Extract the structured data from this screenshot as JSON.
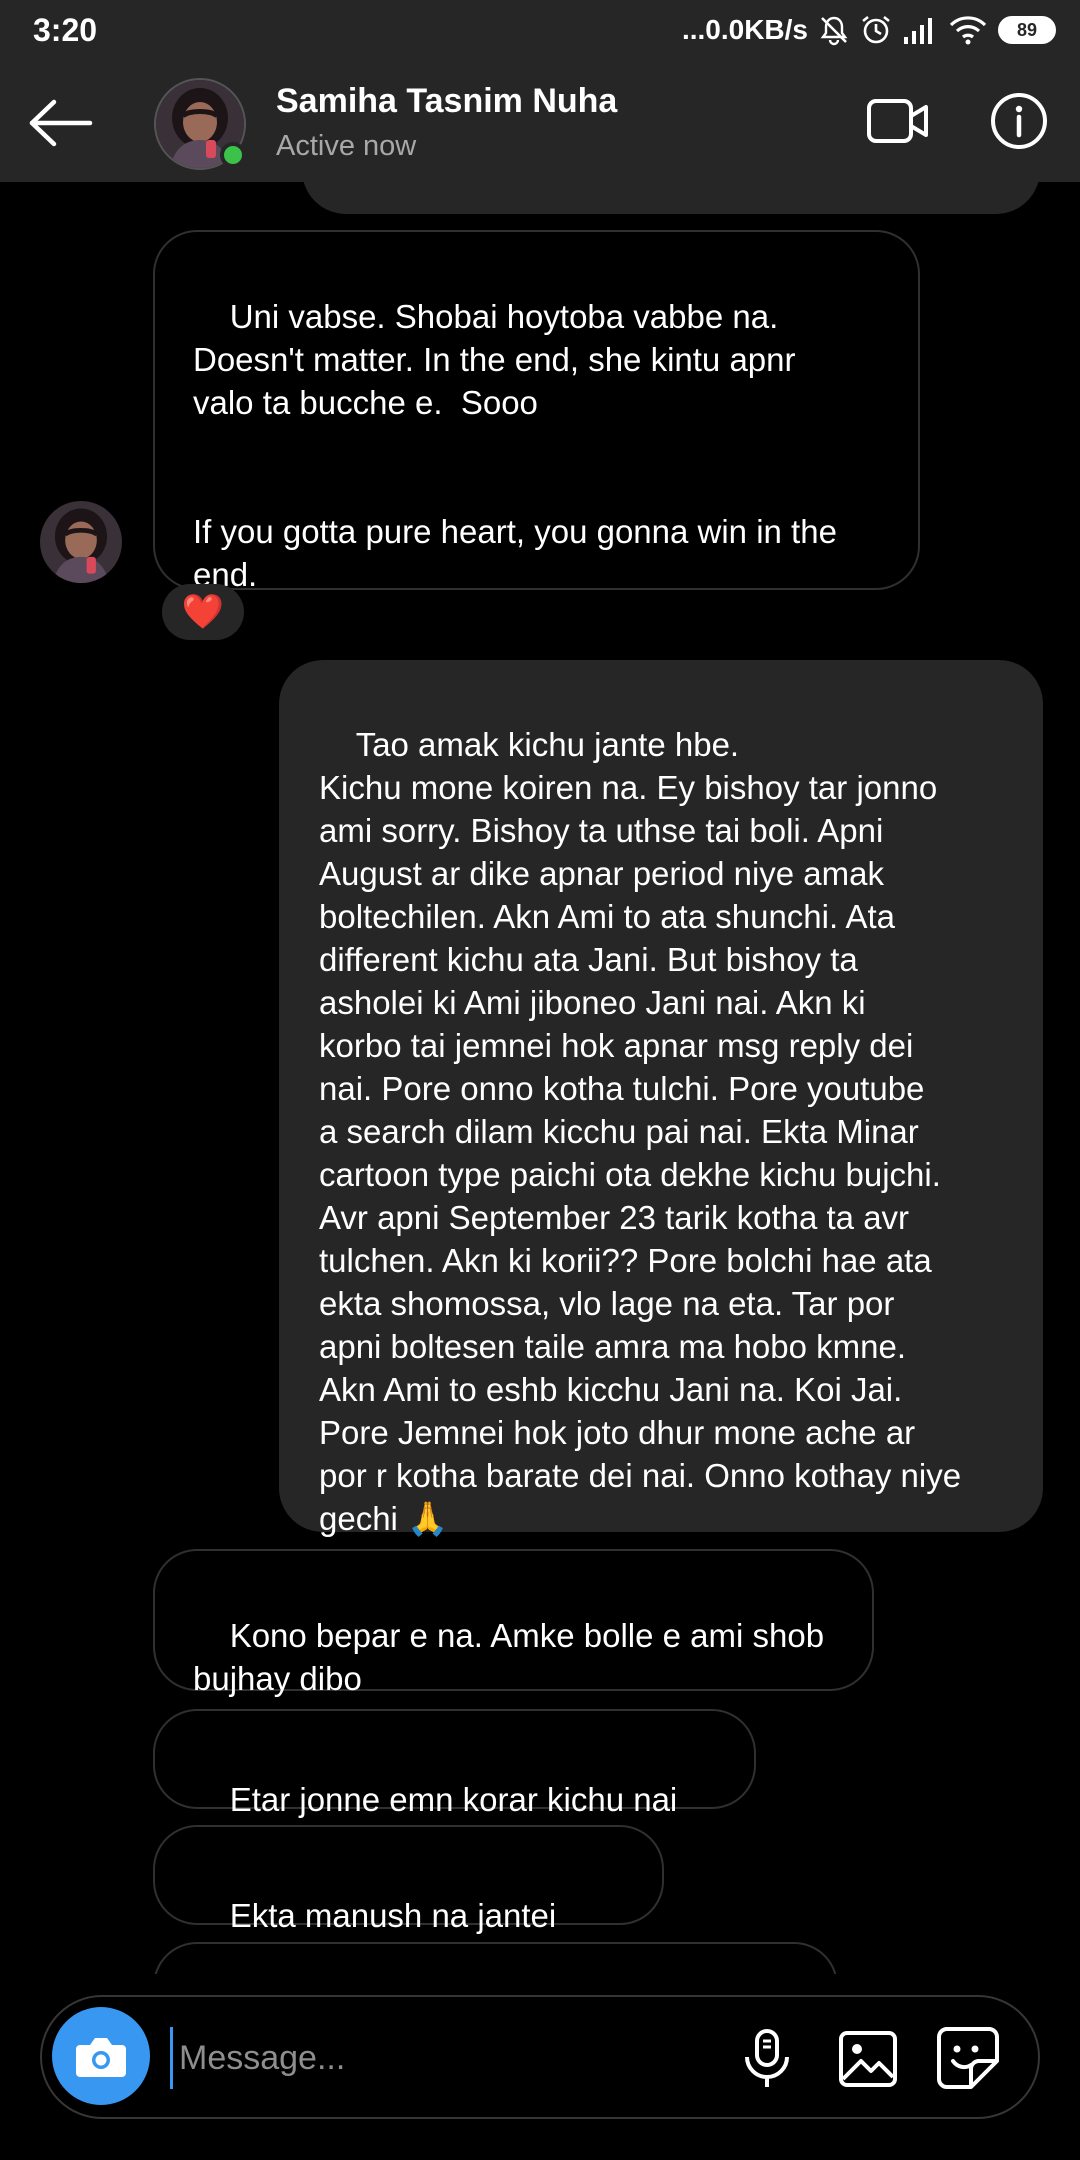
{
  "status_bar": {
    "time": "3:20",
    "net_speed": "...0.0KB/s",
    "battery": "89",
    "icons": [
      "mute-icon",
      "alarm-icon",
      "signal-icon",
      "wifi-icon",
      "battery-icon"
    ]
  },
  "header": {
    "name": "Samiha Tasnim Nuha",
    "status": "Active now",
    "icons": [
      "back-arrow-icon",
      "video-call-icon",
      "info-icon"
    ]
  },
  "messages": [
    {
      "direction": "received",
      "text": "Uni vabse. Shobai hoytoba vabbe na.\nDoesn't matter. In the end, she kintu apnr\nvalo ta bucche e.  Sooo\n\n\nIf you gotta pure heart, you gonna win in the\nend.",
      "reaction": "❤️"
    },
    {
      "direction": "sent",
      "text": "Tao amak kichu jante hbe.\nKichu mone koiren na. Ey bishoy tar jonno\nami sorry. Bishoy ta uthse tai boli. Apni\nAugust ar dike apnar period niye amak\nboltechilen. Akn Ami to ata shunchi. Ata\ndifferent kichu ata Jani. But bishoy ta\nasholei ki Ami jiboneo Jani nai. Akn ki\nkorbo tai jemnei hok apnar msg reply dei\nnai. Pore onno kotha tulchi. Pore youtube\na search dilam kicchu pai nai. Ekta Minar\ncartoon type paichi ota dekhe kichu bujchi.\nAvr apni September 23 tarik kotha ta avr\ntulchen. Akn ki korii?? Pore bolchi hae ata\nekta shomossa, vlo lage na eta. Tar por\napni boltesen taile amra ma hobo kmne.\nAkn Ami to eshb kicchu Jani na. Koi Jai.\nPore Jemnei hok joto dhur mone ache ar\npor r kotha barate dei nai. Onno kothay niye\ngechi 🙏"
    },
    {
      "direction": "received",
      "text": "Kono bepar e na. Amke bolle e ami shob\nbujhay dibo"
    },
    {
      "direction": "received",
      "text": "Etar jonne emn korar kichu nai 😄"
    },
    {
      "direction": "received",
      "text": "Ekta manush na jantei pare."
    }
  ],
  "composer": {
    "placeholder": "Message...",
    "value": "",
    "icons": [
      "camera-icon",
      "microphone-icon",
      "gallery-icon",
      "sticker-icon"
    ]
  },
  "colors": {
    "background": "#000000",
    "bar": "#262626",
    "sent_bubble": "#262626",
    "received_border": "#303030",
    "online": "#3cc24a",
    "accent": "#3897f0",
    "heart": "#ed4956"
  }
}
